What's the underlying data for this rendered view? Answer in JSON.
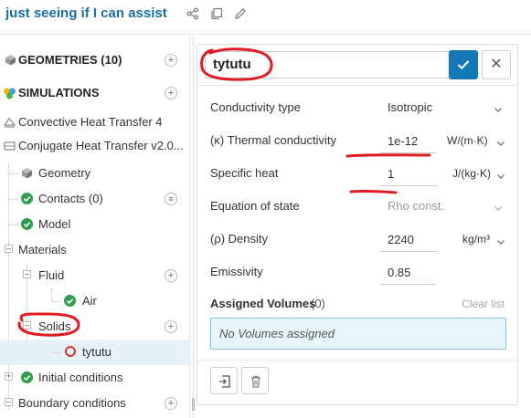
{
  "header": {
    "title": "just seeing if I can assist",
    "icons": [
      "share-icon",
      "copy-icon",
      "edit-icon"
    ]
  },
  "sidebar": {
    "items": [
      {
        "label": "GEOMETRIES (10)",
        "icon": "geometry-cube-icon",
        "action": "+"
      },
      {
        "label": "SIMULATIONS",
        "icon": "simulation-icon",
        "action": "+"
      },
      {
        "label": "Convective Heat Transfer 4",
        "icon": "simulation-type-icon"
      },
      {
        "label": "Conjugate Heat Transfer v2.0...",
        "icon": "simulation-type-icon"
      },
      {
        "label": "Geometry",
        "icon": "geometry-cube-icon"
      },
      {
        "label": "Contacts (0)",
        "icon": "check-circle-icon",
        "action": "filter"
      },
      {
        "label": "Model",
        "icon": "check-circle-icon"
      },
      {
        "label": "Materials",
        "toggle": "-"
      },
      {
        "label": "Fluid",
        "toggle": "-",
        "action": "+"
      },
      {
        "label": "Air",
        "icon": "check-circle-icon"
      },
      {
        "label": "Solids",
        "toggle": "-",
        "action": "+"
      },
      {
        "label": "tytutu",
        "icon": "incomplete-ring-icon",
        "selected": true
      },
      {
        "label": "Initial conditions",
        "toggle": "+",
        "icon": "check-circle-icon"
      },
      {
        "label": "Boundary conditions",
        "toggle": "-",
        "action": "+"
      }
    ]
  },
  "panel": {
    "name_value": "tytutu",
    "properties": [
      {
        "label": "Conductivity type",
        "value": "Isotropic",
        "unit": ""
      },
      {
        "label": "(κ) Thermal conductivity",
        "value": "1e-12",
        "unit": "W/(m·K)"
      },
      {
        "label": "Specific heat",
        "value": "1",
        "unit": "J/(kg·K)"
      },
      {
        "label": "Equation of state",
        "value": "Rho const.",
        "unit": ""
      },
      {
        "label": "(ρ) Density",
        "value": "2240",
        "unit": "kg/m³"
      },
      {
        "label": "Emissivity",
        "value": "0.85",
        "unit": ""
      }
    ],
    "assigned_volumes_label": "Assigned Volumes",
    "assigned_volumes_count": "(0)",
    "clear_list_label": "Clear list",
    "no_volumes_text": "No Volumes assigned"
  },
  "colors": {
    "accent": "#1477b8",
    "title": "#1a6fa1",
    "check": "#2e9e4f",
    "incomplete": "#d9362b",
    "annotation": "#e01b24"
  }
}
